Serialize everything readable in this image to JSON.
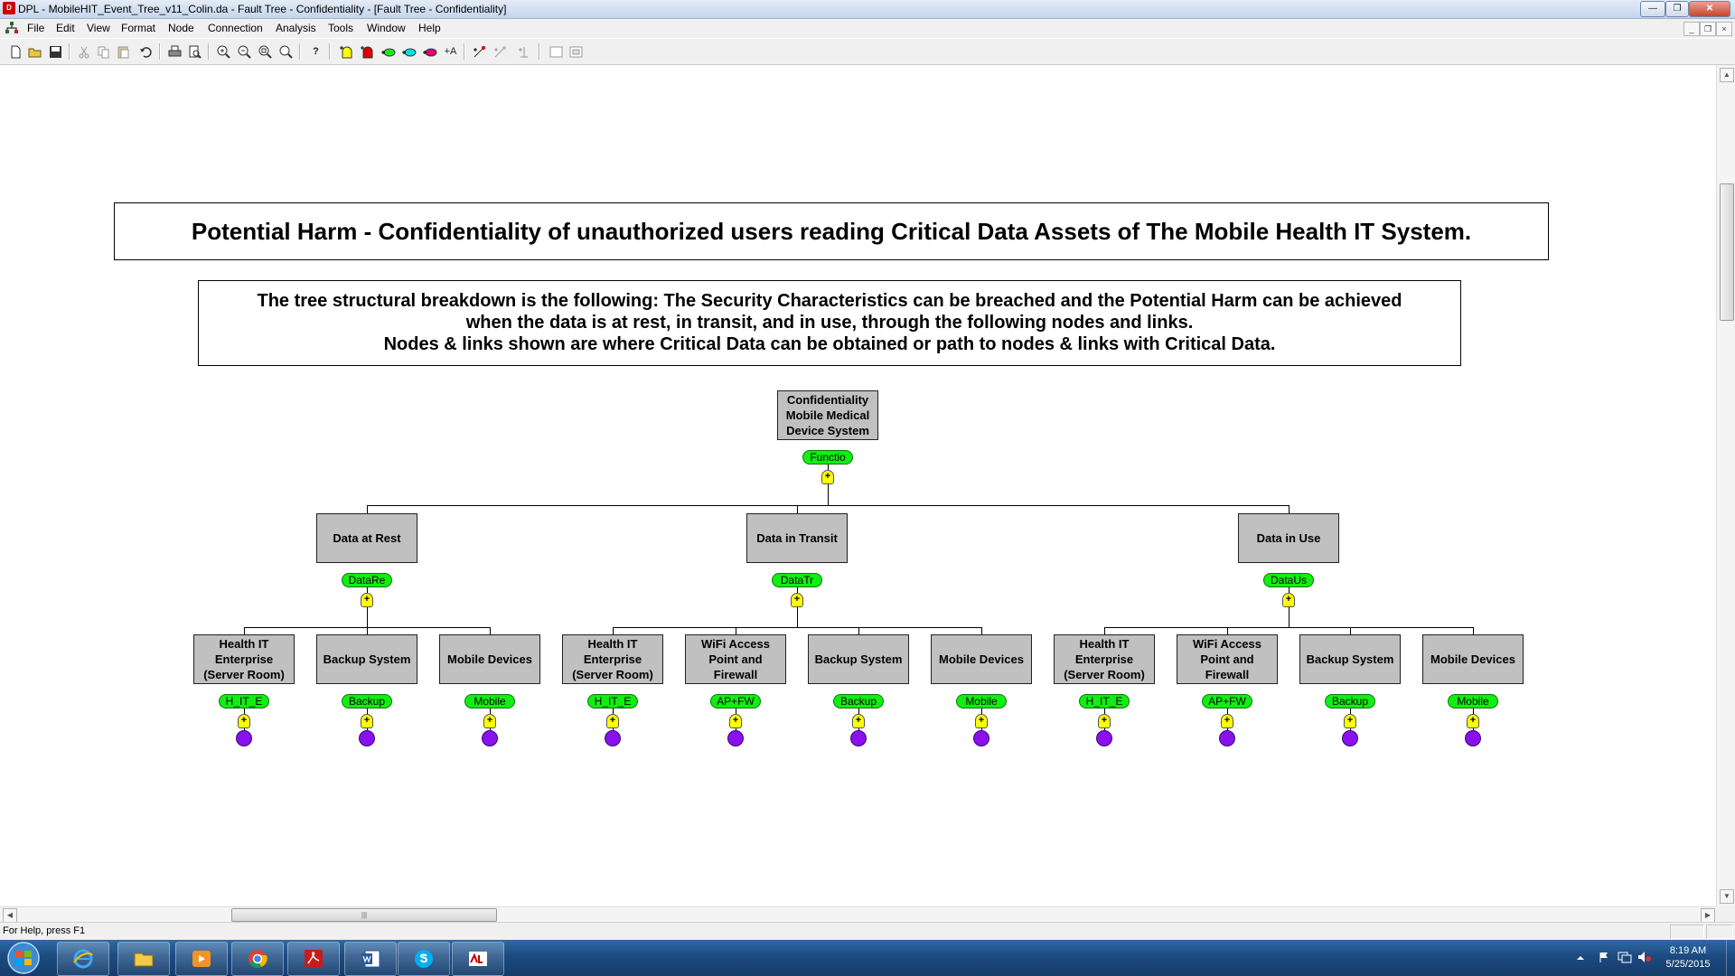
{
  "window": {
    "title": "DPL - MobileHIT_Event_Tree_v11_Colin.da - Fault Tree - Confidentiality - [Fault Tree - Confidentiality]",
    "app_icon": "dpl-app-icon"
  },
  "menu": [
    "File",
    "Edit",
    "View",
    "Format",
    "Node",
    "Connection",
    "Analysis",
    "Tools",
    "Window",
    "Help"
  ],
  "toolbar": {
    "buttons": [
      "new",
      "open",
      "save",
      "cut",
      "copy",
      "paste",
      "undo",
      "print",
      "print-preview",
      "zoom-in",
      "zoom-out",
      "zoom-fit",
      "zoom-custom",
      "help",
      "add-event-node",
      "add-chance-node",
      "add-green-node",
      "add-cyan-node",
      "add-magenta-node",
      "add-text",
      "add-value-node",
      "add-decision",
      "add-gate",
      "view-a",
      "view-b"
    ],
    "text_button": "+A"
  },
  "diagram": {
    "heading": "Potential Harm - Confidentiality of unauthorized users reading Critical Data Assets of The Mobile Health IT System.",
    "description": [
      "The tree structural breakdown is the following: The Security Characteristics can be breached and the Potential Harm can be achieved",
      "when the data is at rest, in transit, and in use, through the following nodes and links.",
      "Nodes & links shown are where Critical Data can be obtained or path to nodes & links with Critical Data."
    ],
    "root": {
      "label": "Confidentiality Mobile Medical Device System",
      "tag": "Functio"
    },
    "groups": [
      {
        "label": "Data at Rest",
        "tag": "DataRe",
        "children": [
          {
            "label": "Health IT Enterprise (Server Room)",
            "tag": "H_IT_E"
          },
          {
            "label": "Backup System",
            "tag": "Backup"
          },
          {
            "label": "Mobile Devices",
            "tag": "Mobile"
          }
        ]
      },
      {
        "label": "Data in Transit",
        "tag": "DataTr",
        "children": [
          {
            "label": "Health IT Enterprise (Server Room)",
            "tag": "H_IT_E"
          },
          {
            "label": "WiFi Access Point and Firewall",
            "tag": "AP+FW"
          },
          {
            "label": "Backup System",
            "tag": "Backup"
          },
          {
            "label": "Mobile Devices",
            "tag": "Mobile"
          }
        ]
      },
      {
        "label": "Data in Use",
        "tag": "DataUs",
        "children": [
          {
            "label": "Health IT Enterprise (Server Room)",
            "tag": "H_IT_E"
          },
          {
            "label": "WiFi Access Point and Firewall",
            "tag": "AP+FW"
          },
          {
            "label": "Backup System",
            "tag": "Backup"
          },
          {
            "label": "Mobile Devices",
            "tag": "Mobile"
          }
        ]
      }
    ],
    "gate_symbol": "+",
    "colors": {
      "node_fill": "#c0c0c0",
      "tag_fill": "#11ee11",
      "gate_fill": "#ffff00",
      "leaf_fill": "#8a10ee"
    }
  },
  "scrollbar": {
    "grip": "|||"
  },
  "status": {
    "text": "For Help, press F1"
  },
  "taskbar": {
    "apps": [
      "internet-explorer-icon",
      "file-explorer-icon",
      "media-player-icon",
      "chrome-icon",
      "acrobat-icon",
      "word-icon",
      "skype-icon",
      "dpl-icon"
    ],
    "clock": {
      "time": "8:19 AM",
      "date": "5/25/2015"
    }
  }
}
